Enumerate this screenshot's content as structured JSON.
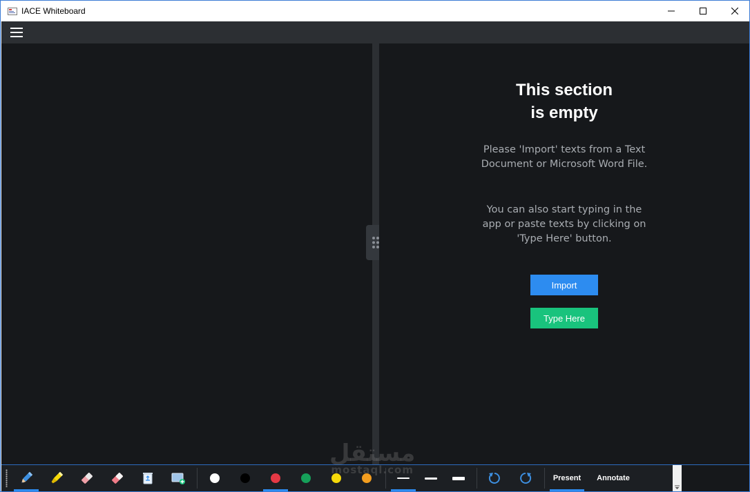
{
  "window": {
    "title": "IACE Whiteboard",
    "controls": [
      "minimize-icon",
      "maximize-icon",
      "close-icon"
    ]
  },
  "header": {
    "menu_icon": "hamburger-menu-icon"
  },
  "empty_state": {
    "title_line1": "This section",
    "title_line2": "is empty",
    "message1_line1": "Please 'Import' texts from a Text",
    "message1_line2": "Document or Microsoft Word File.",
    "message2_line1": "You can also start typing in the",
    "message2_line2": "app or paste texts by clicking on",
    "message2_line3": "'Type Here' button.",
    "import_label": "Import",
    "type_here_label": "Type Here"
  },
  "toolbar": {
    "tools": [
      "pen-icon",
      "highlighter-icon",
      "eraser-icon",
      "partial-eraser-icon",
      "recycle-bin-icon",
      "add-board-icon"
    ],
    "colors": [
      "#ffffff",
      "#000000",
      "#e53945",
      "#16a05a",
      "#f5d90a",
      "#f29d1f"
    ],
    "stroke_widths": [
      "thin",
      "medium",
      "thick"
    ],
    "history": [
      "undo-icon",
      "redo-icon"
    ],
    "modes": {
      "present_label": "Present",
      "annotate_label": "Annotate",
      "active": "Present"
    }
  },
  "colors": {
    "accent": "#2d8cf0",
    "import_button": "#2d8cf0",
    "type_here_button": "#19c37d",
    "pane_background": "#16181b",
    "header_background": "#2c2f33"
  },
  "watermark": {
    "arabic": "مستقل",
    "latin": "mostaql.com"
  }
}
